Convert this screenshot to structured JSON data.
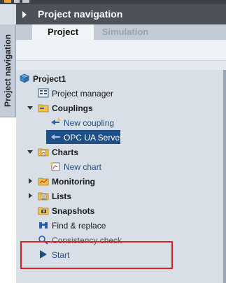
{
  "panel": {
    "title": "Project navigation",
    "side_tab_label": "Project navigation"
  },
  "tabs": [
    {
      "label": "Project",
      "active": true
    },
    {
      "label": "Simulation",
      "active": false
    }
  ],
  "tree": {
    "project_name": "Project1",
    "items": {
      "project_manager": "Project manager",
      "couplings": "Couplings",
      "new_coupling": "New coupling",
      "opc_ua_server": "OPC UA Server",
      "charts": "Charts",
      "new_chart": "New chart",
      "monitoring": "Monitoring",
      "lists": "Lists",
      "snapshots": "Snapshots",
      "find_replace": "Find & replace",
      "consistency_check": "Consistency check",
      "start": "Start"
    }
  },
  "colors": {
    "title_bar": "#4c515a",
    "selection": "#1e4f86",
    "highlight_box": "#e02020"
  }
}
